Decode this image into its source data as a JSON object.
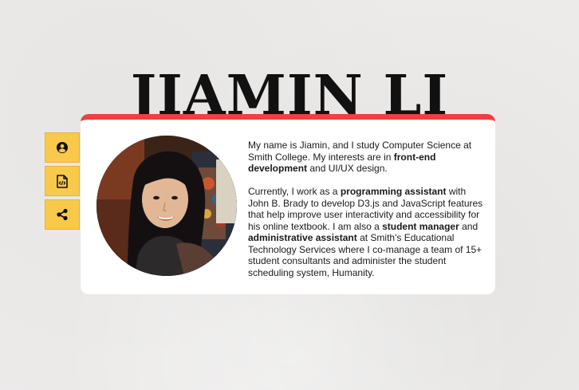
{
  "header": {
    "name": "JIAMIN LI"
  },
  "sidebar": {
    "tabs": [
      {
        "icon": "user-circle-icon"
      },
      {
        "icon": "code-file-icon"
      },
      {
        "icon": "share-icon"
      }
    ],
    "color": "#f8c94a"
  },
  "card": {
    "accent_color": "#ef4040",
    "photo_alt": "portrait",
    "bio": {
      "p1": {
        "t1": "My name is Jiamin, and I study Computer Science at Smith College. My interests are in ",
        "b1": "front-end development",
        "t2": " and UI/UX design."
      },
      "p2": {
        "t1": "Currently, I work as a ",
        "b1": "programming assistant",
        "t2": " with John B. Brady to develop D3.js and JavaScript features that help improve user interactivity and accessibility for his online textbook. I am also a ",
        "b2": "student manager",
        "t3": " and ",
        "b3": "administrative assistant",
        "t4": " at Smith's Educational Technology Services where I co-manage a team of 15+ student consultants and administer the student scheduling system, Humanity."
      }
    }
  }
}
